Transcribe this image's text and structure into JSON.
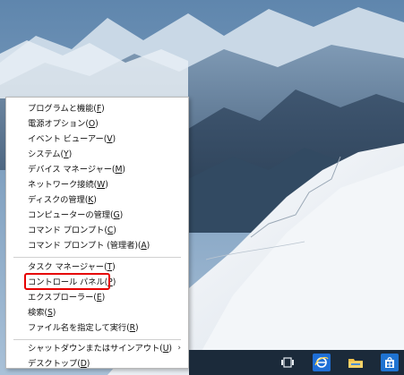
{
  "desktop": {
    "wallpaper": "snowy-mountain-landscape"
  },
  "start_context_menu": {
    "groups": [
      {
        "items": [
          {
            "label": "プログラムと機能",
            "key": "F"
          },
          {
            "label": "電源オプション",
            "key": "O"
          },
          {
            "label": "イベント ビューアー",
            "key": "V"
          },
          {
            "label": "システム",
            "key": "Y"
          },
          {
            "label": "デバイス マネージャー",
            "key": "M"
          },
          {
            "label": "ネットワーク接続",
            "key": "W"
          },
          {
            "label": "ディスクの管理",
            "key": "K"
          },
          {
            "label": "コンピューターの管理",
            "key": "G"
          },
          {
            "label": "コマンド プロンプト",
            "key": "C"
          },
          {
            "label": "コマンド プロンプト (管理者)",
            "key": "A"
          }
        ]
      },
      {
        "items": [
          {
            "label": "タスク マネージャー",
            "key": "T"
          },
          {
            "label": "コントロール パネル",
            "key": "P",
            "highlighted": true
          },
          {
            "label": "エクスプローラー",
            "key": "E"
          },
          {
            "label": "検索",
            "key": "S"
          },
          {
            "label": "ファイル名を指定して実行",
            "key": "R"
          }
        ]
      },
      {
        "items": [
          {
            "label": "シャットダウンまたはサインアウト",
            "key": "U",
            "submenu_arrow": "›"
          },
          {
            "label": "デスクトップ",
            "key": "D"
          }
        ]
      }
    ]
  },
  "highlight_color": "#e60000",
  "taskbar": {
    "icons": [
      "task-view-icon",
      "internet-explorer-icon",
      "file-explorer-icon",
      "store-icon"
    ]
  }
}
